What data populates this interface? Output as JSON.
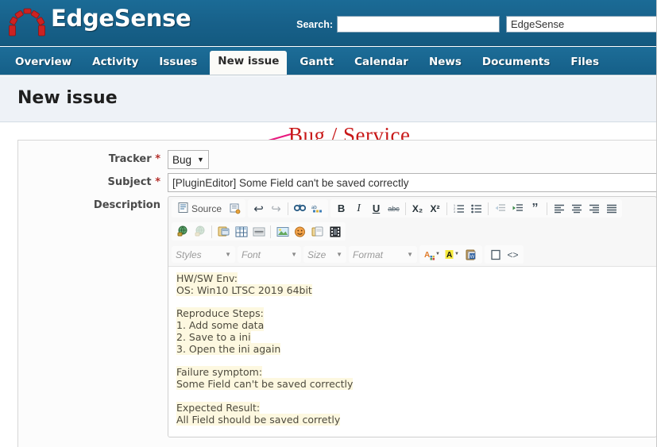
{
  "header": {
    "app_title": "EdgeSense",
    "logo_icon": "arch-logo-icon",
    "search_label": "Search:",
    "search_value": "",
    "search_placeholder": "",
    "project_value": "EdgeSense",
    "banner_color": "#176089"
  },
  "nav": {
    "items": [
      {
        "label": "Overview",
        "selected": false
      },
      {
        "label": "Activity",
        "selected": false
      },
      {
        "label": "Issues",
        "selected": false
      },
      {
        "label": "New issue",
        "selected": true
      },
      {
        "label": "Gantt",
        "selected": false
      },
      {
        "label": "Calendar",
        "selected": false
      },
      {
        "label": "News",
        "selected": false
      },
      {
        "label": "Documents",
        "selected": false
      },
      {
        "label": "Files",
        "selected": false
      }
    ]
  },
  "page": {
    "title": "New issue"
  },
  "annotation": {
    "text": "Bug / Service",
    "color": "#c81818",
    "arrow_color": "#e8187e"
  },
  "form": {
    "tracker": {
      "label": "Tracker",
      "required_mark": "*",
      "value": "Bug",
      "caret": "▼"
    },
    "subject": {
      "label": "Subject",
      "required_mark": "*",
      "value": "[PluginEditor] Some Field can't be saved correctly",
      "placeholder": ""
    },
    "description": {
      "label": "Description",
      "required_mark": ""
    }
  },
  "editor": {
    "toolbar_row1": [
      {
        "name": "source-button",
        "label": "Source",
        "glyph": "☰",
        "type": "wide"
      },
      {
        "name": "templates-icon",
        "label": "",
        "glyph": "▤",
        "type": "icon"
      },
      {
        "name": "undo-icon",
        "label": "",
        "glyph": "↩",
        "type": "icon"
      },
      {
        "name": "redo-icon",
        "label": "",
        "glyph": "↪",
        "type": "icon-dim"
      },
      {
        "name": "find-icon",
        "label": "",
        "glyph": "🔍",
        "type": "icon"
      },
      {
        "name": "replace-icon",
        "label": "",
        "glyph": "⚖",
        "type": "icon"
      },
      {
        "name": "bold-button",
        "label": "B",
        "glyph": "B",
        "type": "icon"
      },
      {
        "name": "italic-button",
        "label": "I",
        "glyph": "I",
        "type": "icon"
      },
      {
        "name": "underline-button",
        "label": "U",
        "glyph": "U",
        "type": "icon"
      },
      {
        "name": "strikethrough-button",
        "label": "abc",
        "glyph": "abc",
        "type": "icon"
      },
      {
        "name": "subscript-button",
        "label": "X2",
        "glyph": "X₂",
        "type": "icon"
      },
      {
        "name": "superscript-button",
        "label": "X2",
        "glyph": "X²",
        "type": "icon"
      },
      {
        "name": "numbered-list-button",
        "label": "",
        "glyph": "≣",
        "type": "icon"
      },
      {
        "name": "bulleted-list-button",
        "label": "",
        "glyph": "≣",
        "type": "icon"
      },
      {
        "name": "outdent-button",
        "label": "",
        "glyph": "≣",
        "type": "icon-dim"
      },
      {
        "name": "indent-button",
        "label": "",
        "glyph": "≣",
        "type": "icon"
      },
      {
        "name": "blockquote-button",
        "label": "",
        "glyph": "”",
        "type": "icon"
      },
      {
        "name": "align-left-button",
        "label": "",
        "glyph": "≡",
        "type": "icon"
      },
      {
        "name": "align-center-button",
        "label": "",
        "glyph": "≡",
        "type": "icon"
      },
      {
        "name": "align-right-button",
        "label": "",
        "glyph": "≡",
        "type": "icon"
      },
      {
        "name": "align-justify-button",
        "label": "",
        "glyph": "≡",
        "type": "icon"
      }
    ],
    "toolbar_row2": [
      {
        "name": "link-icon"
      },
      {
        "name": "unlink-icon"
      },
      {
        "name": "anchor-icon"
      },
      {
        "name": "table-icon"
      },
      {
        "name": "horizontal-rule-icon"
      },
      {
        "name": "image-icon"
      },
      {
        "name": "smiley-icon"
      },
      {
        "name": "page-break-icon"
      },
      {
        "name": "media-icon"
      }
    ],
    "toolbar_row3": {
      "styles_label": "Styles",
      "font_label": "Font",
      "size_label": "Size",
      "format_label": "Format",
      "text_color_label": "A",
      "bg_color_label": "A",
      "paste_word_name": "paste-from-word-icon",
      "maximize_name": "maximize-icon",
      "show_blocks_label": "<>"
    },
    "body_lines": [
      "HW/SW Env:",
      "OS: Win10 LTSC 2019 64bit",
      "",
      "Reproduce Steps:",
      "1. Add some data",
      "2. Save to a ini",
      "3. Open the ini again",
      "",
      "Failure symptom:",
      "Some Field can't be saved correctly",
      "",
      "Expected Result:",
      "All Field should be saved corretly"
    ],
    "highlight_color": "#fdf8e0"
  }
}
